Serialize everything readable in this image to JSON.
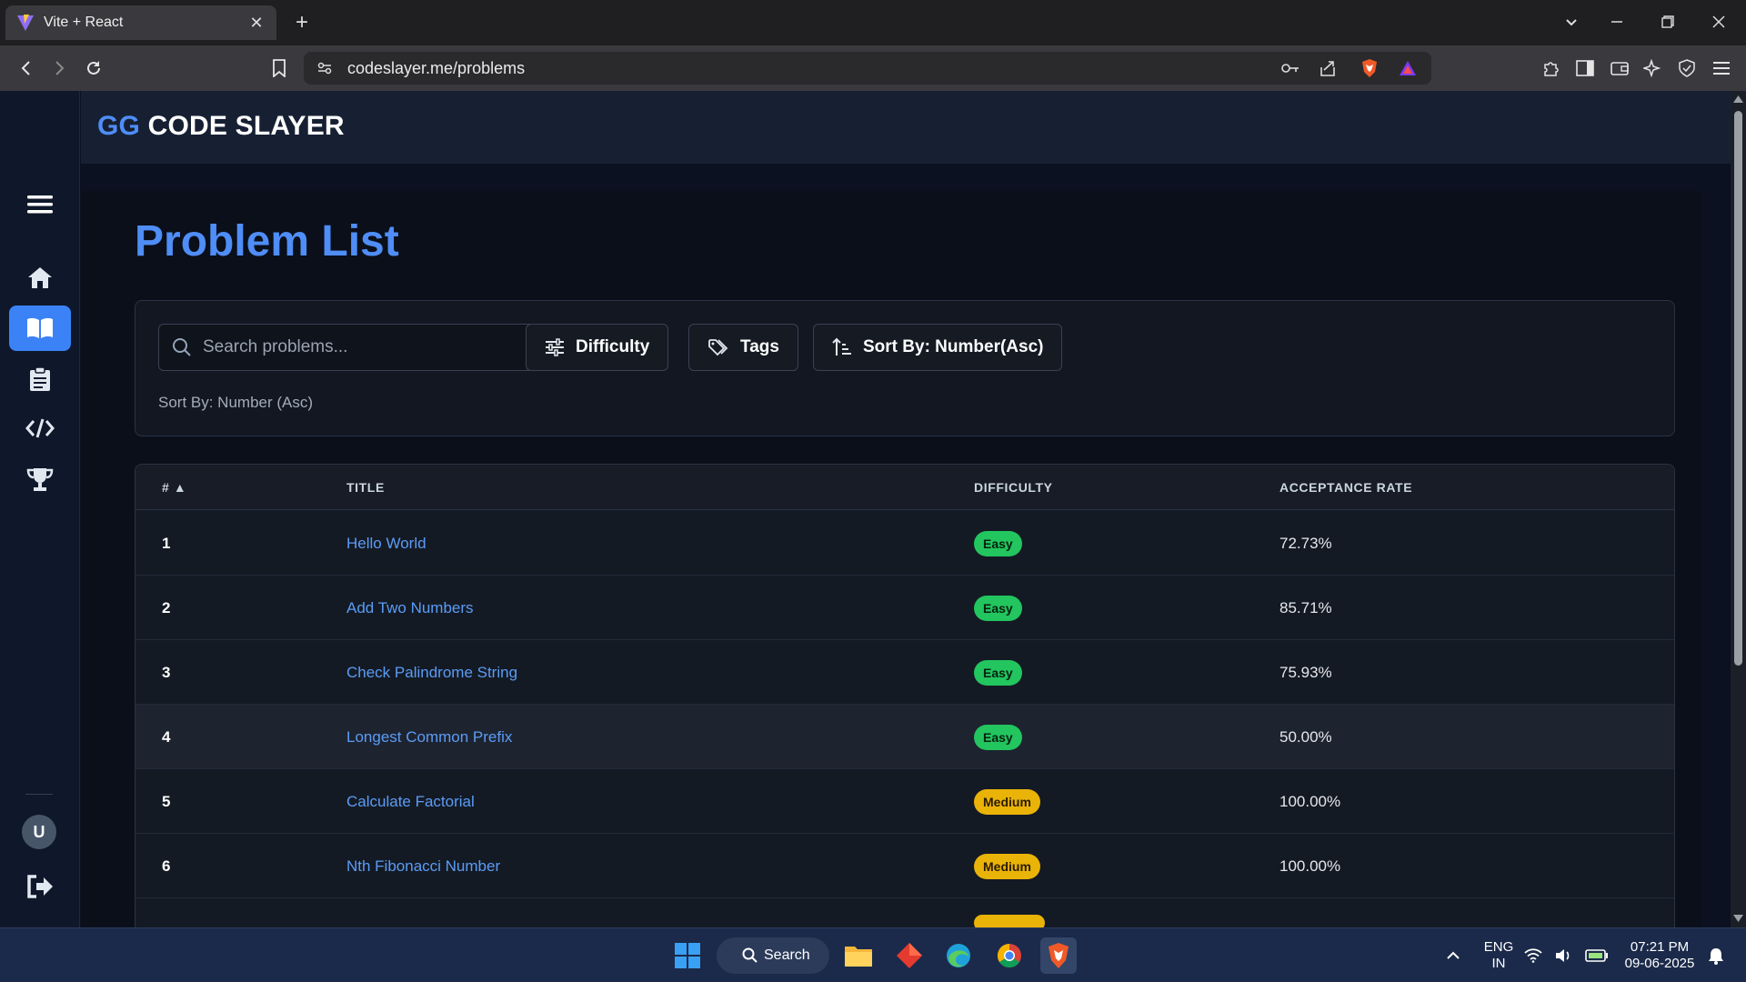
{
  "browser": {
    "tab_title": "Vite + React",
    "url": "codeslayer.me/problems"
  },
  "app": {
    "logo_prefix": "GG",
    "logo_name": "CODE SLAYER",
    "sidebar": [
      {
        "icon": "home-icon",
        "active": false
      },
      {
        "icon": "book-icon",
        "active": true
      },
      {
        "icon": "clipboard-icon",
        "active": false
      },
      {
        "icon": "code-icon",
        "active": false
      },
      {
        "icon": "trophy-icon",
        "active": false
      }
    ],
    "avatar_letter": "U"
  },
  "page": {
    "title": "Problem List",
    "search_placeholder": "Search problems...",
    "difficulty_label": "Difficulty",
    "tags_label": "Tags",
    "sort_label": "Sort By: Number(Asc)",
    "sort_caption": "Sort By: Number (Asc)"
  },
  "table": {
    "headers": {
      "num": "# ▲",
      "title": "TITLE",
      "difficulty": "DIFFICULTY",
      "rate": "ACCEPTANCE RATE"
    },
    "rows": [
      {
        "num": "1",
        "title": "Hello World",
        "difficulty": "Easy",
        "rate": "72.73%"
      },
      {
        "num": "2",
        "title": "Add Two Numbers",
        "difficulty": "Easy",
        "rate": "85.71%"
      },
      {
        "num": "3",
        "title": "Check Palindrome String",
        "difficulty": "Easy",
        "rate": "75.93%"
      },
      {
        "num": "4",
        "title": "Longest Common Prefix",
        "difficulty": "Easy",
        "rate": "50.00%"
      },
      {
        "num": "5",
        "title": "Calculate Factorial",
        "difficulty": "Medium",
        "rate": "100.00%"
      },
      {
        "num": "6",
        "title": "Nth Fibonacci Number",
        "difficulty": "Medium",
        "rate": "100.00%"
      }
    ]
  },
  "colors": {
    "accent": "#4f8df7",
    "easy_bg": "#22c55e",
    "medium_bg": "#eab308"
  },
  "taskbar": {
    "search_label": "Search",
    "lang_top": "ENG",
    "lang_bottom": "IN",
    "time": "07:21 PM",
    "date": "09-06-2025"
  }
}
